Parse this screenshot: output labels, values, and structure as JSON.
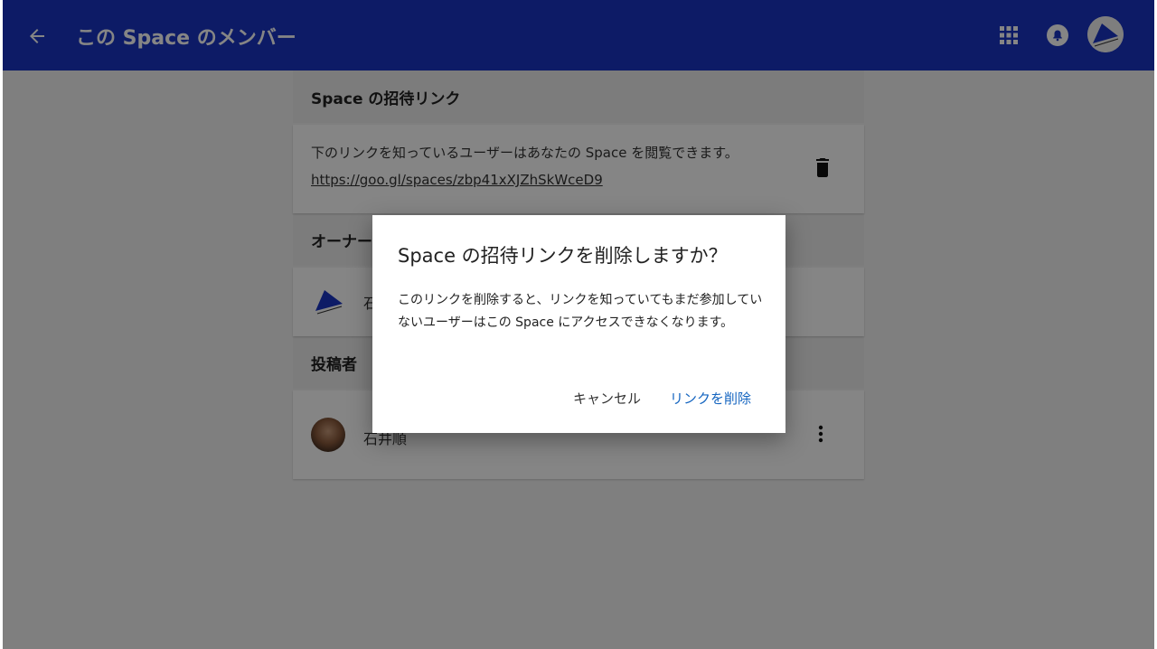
{
  "header": {
    "title": "この Space のメンバー"
  },
  "invite_section": {
    "header": "Space の招待リンク",
    "description": "下のリンクを知っているユーザーはあなたの Space を閲覧できます。",
    "url": "https://goo.gl/spaces/zbp41xXJZhSkWceD9"
  },
  "owner_section": {
    "header": "オーナー",
    "name": "石"
  },
  "poster_section": {
    "header": "投稿者",
    "name": "石井順"
  },
  "dialog": {
    "title": "Space の招待リンクを削除しますか？",
    "body": "このリンクを削除すると、リンクを知っていてもまだ参加していないユーザーはこの Space にアクセスできなくなります。",
    "cancel_label": "キャンセル",
    "delete_label": "リンクを削除"
  },
  "colors": {
    "app_bar": "#1a35c4",
    "accent": "#1565c0",
    "scrim": "rgba(0,0,0,0.48)"
  },
  "icons": [
    "arrow-back-icon",
    "apps-grid-icon",
    "bell-icon",
    "trash-icon",
    "more-vert-icon"
  ]
}
